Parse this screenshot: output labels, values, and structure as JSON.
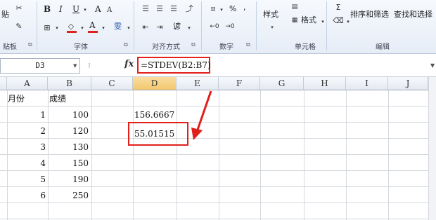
{
  "ribbon": {
    "clipboard": {
      "paste_label": "贴",
      "label": "贴板"
    },
    "font": {
      "bold": "B",
      "italic": "I",
      "underline": "U",
      "grow": "A",
      "shrink": "A",
      "font_color": "A",
      "phonetic": "雯",
      "label": "字体"
    },
    "alignment": {
      "label": "对齐方式",
      "wrap": "谚"
    },
    "number": {
      "percent": "%",
      "comma": ",",
      "label": "数字"
    },
    "styles": {
      "style_label": "样式",
      "format_label": "格式",
      "label": "单元格"
    },
    "editing": {
      "sort_filter": "排序和筛选",
      "find_select": "查找和选择",
      "label": "编辑"
    }
  },
  "formula_bar": {
    "name_box": "D3",
    "fx": "fx",
    "formula": "=STDEV(B2:B7)"
  },
  "grid": {
    "columns": [
      "A",
      "B",
      "C",
      "D",
      "E",
      "F",
      "G",
      "H",
      "I",
      "J"
    ],
    "header_row": {
      "a": "月份",
      "b": "成绩"
    },
    "rows": [
      {
        "month": "1",
        "score": "100"
      },
      {
        "month": "2",
        "score": "120"
      },
      {
        "month": "3",
        "score": "130"
      },
      {
        "month": "4",
        "score": "150"
      },
      {
        "month": "5",
        "score": "190"
      },
      {
        "month": "6",
        "score": "250"
      }
    ],
    "d2": "156.6667",
    "d3": "55.01515"
  },
  "colors": {
    "highlight": "#e0201b",
    "ribbon_bg": "#e6edf7"
  }
}
